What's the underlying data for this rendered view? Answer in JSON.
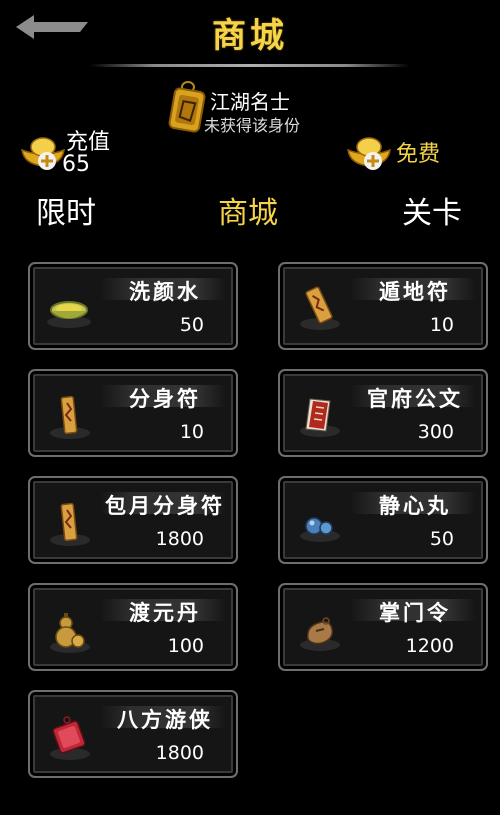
{
  "header": {
    "title": "商城"
  },
  "identity": {
    "name": "江湖名士",
    "status": "未获得该身份"
  },
  "currency": {
    "recharge_label": "充值",
    "recharge_value": "65",
    "free_label": "免费"
  },
  "tabs": [
    {
      "label": "限时"
    },
    {
      "label": "商城",
      "active": true
    },
    {
      "label": "关卡"
    }
  ],
  "items": [
    {
      "name": "洗颜水",
      "price": "50",
      "icon": "bowl-icon"
    },
    {
      "name": "遁地符",
      "price": "10",
      "icon": "talisman-icon"
    },
    {
      "name": "分身符",
      "price": "10",
      "icon": "talisman-icon"
    },
    {
      "name": "官府公文",
      "price": "300",
      "icon": "document-icon"
    },
    {
      "name": "包月分身符",
      "price": "1800",
      "icon": "talisman-icon"
    },
    {
      "name": "静心丸",
      "price": "50",
      "icon": "pill-icon"
    },
    {
      "name": "渡元丹",
      "price": "100",
      "icon": "gourd-icon"
    },
    {
      "name": "掌门令",
      "price": "1200",
      "icon": "token-icon"
    },
    {
      "name": "八方游侠",
      "price": "1800",
      "icon": "scroll-card-icon"
    }
  ],
  "colors": {
    "accent_gold": "#f5d44a",
    "background": "#000000",
    "card_border": "#6e6e6e"
  }
}
